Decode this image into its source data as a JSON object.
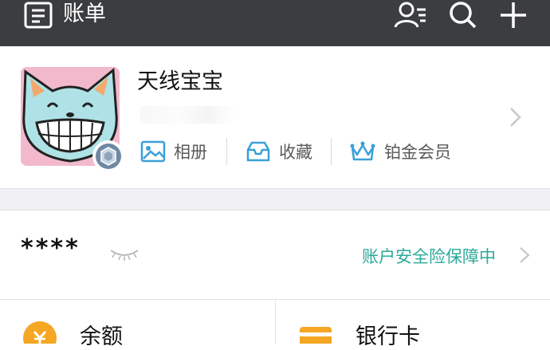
{
  "header": {
    "title": "账单",
    "icons": [
      "bill-icon",
      "contacts-icon",
      "search-icon",
      "add-icon"
    ]
  },
  "profile": {
    "nickname": "天线宝宝",
    "avatar_icon": "cartoon-cat-avatar",
    "badge_icon": "member-badge-icon",
    "links": [
      {
        "label": "相册",
        "icon": "photo-album-icon"
      },
      {
        "label": "收藏",
        "icon": "favorites-icon"
      },
      {
        "label": "铂金会员",
        "icon": "crown-icon"
      }
    ]
  },
  "balance_row": {
    "masked_amount": "****",
    "eye_icon": "eye-closed-icon",
    "security_text": "账户安全险保障中"
  },
  "grid": [
    {
      "label": "余额",
      "icon": "balance-icon"
    },
    {
      "label": "银行卡",
      "icon": "bank-card-icon"
    }
  ],
  "colors": {
    "topbar": "#3b3d40",
    "accent": "#2ba89a",
    "icon_blue": "#3aa0d8",
    "balance_orange": "#f5a623",
    "card_orange": "#f5a623"
  }
}
